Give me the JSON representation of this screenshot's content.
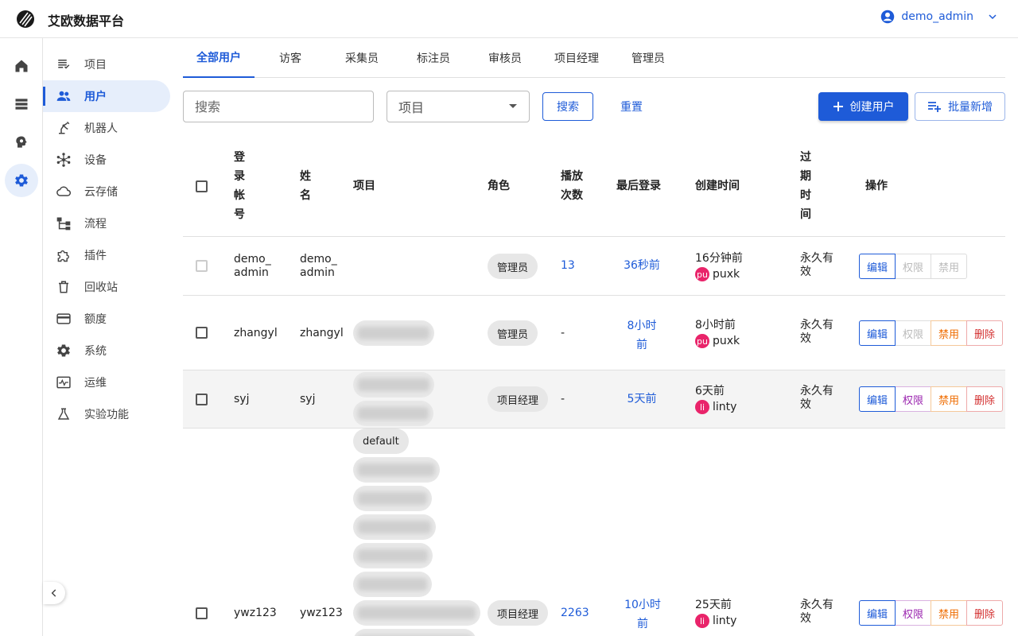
{
  "app": {
    "title": "艾欧数据平台",
    "user": "demo_admin"
  },
  "sidebar": {
    "items": [
      {
        "label": "项目",
        "icon": "list-icon"
      },
      {
        "label": "用户",
        "icon": "users-icon",
        "active": true
      },
      {
        "label": "机器人",
        "icon": "robot-arm-icon"
      },
      {
        "label": "设备",
        "icon": "device-network-icon"
      },
      {
        "label": "云存储",
        "icon": "cloud-icon"
      },
      {
        "label": "流程",
        "icon": "flow-icon"
      },
      {
        "label": "插件",
        "icon": "puzzle-icon"
      },
      {
        "label": "回收站",
        "icon": "trash-icon"
      },
      {
        "label": "额度",
        "icon": "credit-card-icon"
      },
      {
        "label": "系统",
        "icon": "gear-icon"
      },
      {
        "label": "运维",
        "icon": "monitor-icon"
      },
      {
        "label": "实验功能",
        "icon": "flask-icon"
      }
    ]
  },
  "tabs": [
    {
      "label": "全部用户",
      "active": true
    },
    {
      "label": "访客"
    },
    {
      "label": "采集员"
    },
    {
      "label": "标注员"
    },
    {
      "label": "审核员"
    },
    {
      "label": "项目经理"
    },
    {
      "label": "管理员"
    }
  ],
  "filters": {
    "search_placeholder": "搜索",
    "project_placeholder": "项目",
    "search_button": "搜索",
    "reset_button": "重置",
    "create_button": "创建用户",
    "bulk_button": "批量新增"
  },
  "table": {
    "headers": {
      "account": "登\n录\n帐\n号",
      "name": "姓\n名",
      "project": "项目",
      "role": "角色",
      "plays": "播放\n次数",
      "last_login": "最后登录",
      "created": "创建时间",
      "expiry": "过\n期\n时\n间",
      "actions": "操作"
    },
    "actions": {
      "edit": "编辑",
      "perm": "权限",
      "ban": "禁用",
      "del": "删除"
    },
    "rows": [
      {
        "account": "demo_\nadmin",
        "name": "demo_\nadmin",
        "role": "管理员",
        "plays": "13",
        "last_login": "36秒前",
        "created": "16分钟前",
        "creator_avatar": "pu",
        "creator": "puxk",
        "expiry": "永久有\n效"
      },
      {
        "account": "zhangyl",
        "name": "zhangyl",
        "role": "管理员",
        "plays": "-",
        "last_login": "8小时\n前",
        "created": "8小时前",
        "creator_avatar": "pu",
        "creator": "puxk",
        "expiry": "永久有\n效"
      },
      {
        "account": "syj",
        "name": "syj",
        "role": "项目经理",
        "plays": "-",
        "last_login": "5天前",
        "created": "6天前",
        "creator_avatar": "li",
        "creator": "linty",
        "expiry": "永久有\n效"
      },
      {
        "account": "ywz123",
        "name": "ywz123",
        "project_chip": "default",
        "role": "项目经理",
        "plays": "2263",
        "last_login": "10小时\n前",
        "created": "25天前",
        "creator_avatar": "li",
        "creator": "linty",
        "expiry": "永久有\n效"
      }
    ]
  },
  "colors": {
    "primary": "#1e5bd8",
    "avatar": "#e9246a",
    "permission": "#9c27b0",
    "ban": "#ef6c00",
    "delete": "#d32f2f"
  }
}
